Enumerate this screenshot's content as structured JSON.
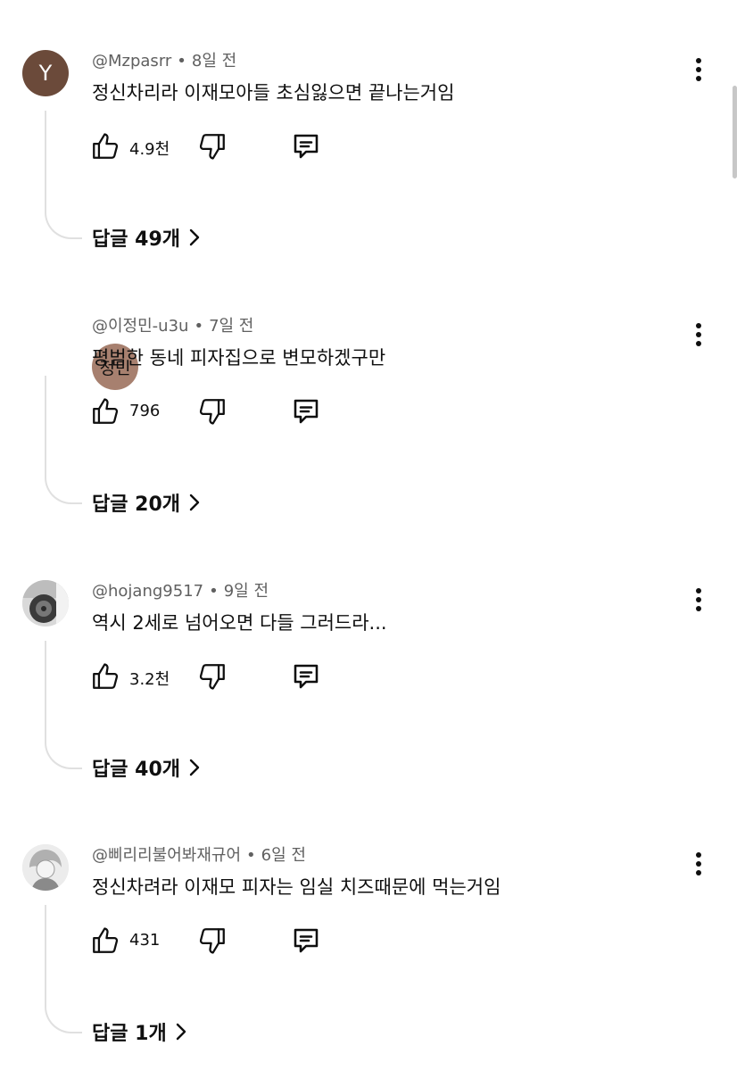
{
  "comments": [
    {
      "avatar_letter": "Y",
      "author": "@Mzpasrr",
      "time": "8일 전",
      "text": "정신차리라 이재모아들 초심잃으면 끝나는거임",
      "likes": "4.9천",
      "replies_label": "답글 49개"
    },
    {
      "avatar_letter": "정민",
      "author": "@이정민-u3u",
      "time": "7일 전",
      "text": "평범한 동네 피자집으로 변모하겠구만",
      "likes": "796",
      "replies_label": "답글 20개"
    },
    {
      "avatar_letter": "",
      "author": "@hojang9517",
      "time": "9일 전",
      "text": "역시 2세로 넘어오면 다들 그러드라...",
      "likes": "3.2천",
      "replies_label": "답글 40개"
    },
    {
      "avatar_letter": "",
      "author": "@삐리리불어봐재규어",
      "time": "6일 전",
      "text": "정신차려라 이재모 피자는 임실 치즈때문에 먹는거임",
      "likes": "431",
      "replies_label": "답글 1개"
    }
  ],
  "separator": "•",
  "colors": {
    "text": "#0f0f0f",
    "meta": "#606060",
    "thread_line": "#e0e0e0",
    "avatar_y": "#6b4a3a",
    "avatar_jm": "#a7806f"
  },
  "icons": [
    "like-icon",
    "dislike-icon",
    "reply-icon",
    "more-vertical-icon",
    "chevron-right-icon"
  ]
}
